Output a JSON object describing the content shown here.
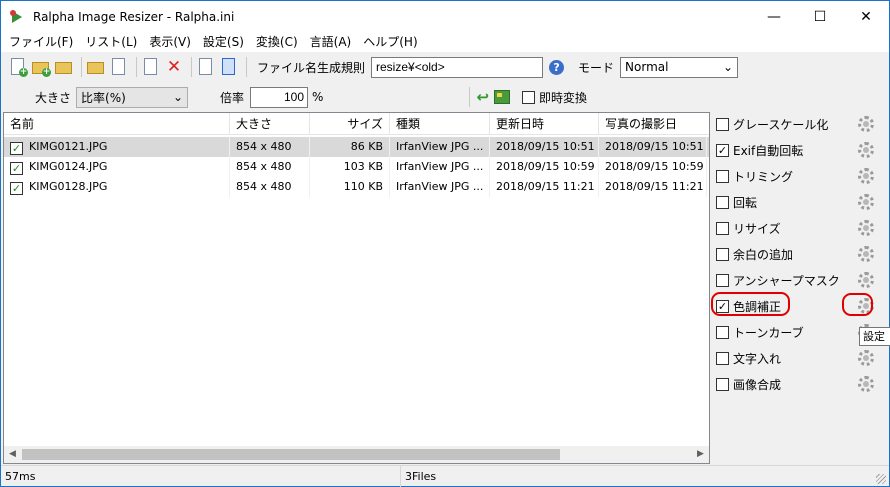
{
  "window": {
    "title": "Ralpha Image Resizer - Ralpha.ini",
    "minimize_glyph": "—",
    "maximize_glyph": "☐",
    "close_glyph": "✕"
  },
  "menu": [
    "ファイル(F)",
    "リスト(L)",
    "表示(V)",
    "設定(S)",
    "変換(C)",
    "言語(A)",
    "ヘルプ(H)"
  ],
  "toolbar": {
    "filename_rule_label": "ファイル名生成規則",
    "filename_rule_value": "resize¥<old>",
    "mode_label": "モード",
    "mode_value": "Normal"
  },
  "toolbar2": {
    "size_label": "大きさ",
    "size_value": "比率(%)",
    "ratio_label": "倍率",
    "ratio_value": "100",
    "ratio_unit": "%",
    "instant_convert_label": "即時変換"
  },
  "list": {
    "columns": [
      "名前",
      "大きさ",
      "サイズ",
      "種類",
      "更新日時",
      "写真の撮影日"
    ],
    "rows": [
      {
        "name": "KIMG0121.JPG",
        "dimensions": "854 x 480",
        "size": "86 KB",
        "type": "IrfanView JPG ...",
        "modified": "2018/09/15 10:51",
        "taken": "2018/09/15 10:51"
      },
      {
        "name": "KIMG0124.JPG",
        "dimensions": "854 x 480",
        "size": "103 KB",
        "type": "IrfanView JPG ...",
        "modified": "2018/09/15 10:59",
        "taken": "2018/09/15 10:59"
      },
      {
        "name": "KIMG0128.JPG",
        "dimensions": "854 x 480",
        "size": "110 KB",
        "type": "IrfanView JPG ...",
        "modified": "2018/09/15 11:21",
        "taken": "2018/09/15 11:21"
      }
    ]
  },
  "panel": {
    "items": [
      {
        "label": "グレースケール化",
        "checked": false
      },
      {
        "label": "Exif自動回転",
        "checked": true
      },
      {
        "label": "トリミング",
        "checked": false
      },
      {
        "label": "回転",
        "checked": false
      },
      {
        "label": "リサイズ",
        "checked": false
      },
      {
        "label": "余白の追加",
        "checked": false
      },
      {
        "label": "アンシャープマスク",
        "checked": false
      },
      {
        "label": "色調補正",
        "checked": true
      },
      {
        "label": "トーンカーブ",
        "checked": false
      },
      {
        "label": "文字入れ",
        "checked": false
      },
      {
        "label": "画像合成",
        "checked": false
      }
    ],
    "tooltip": "設定",
    "highlight_color": "#e00000"
  },
  "status": {
    "elapsed": "57ms",
    "file_count": "3Files"
  }
}
